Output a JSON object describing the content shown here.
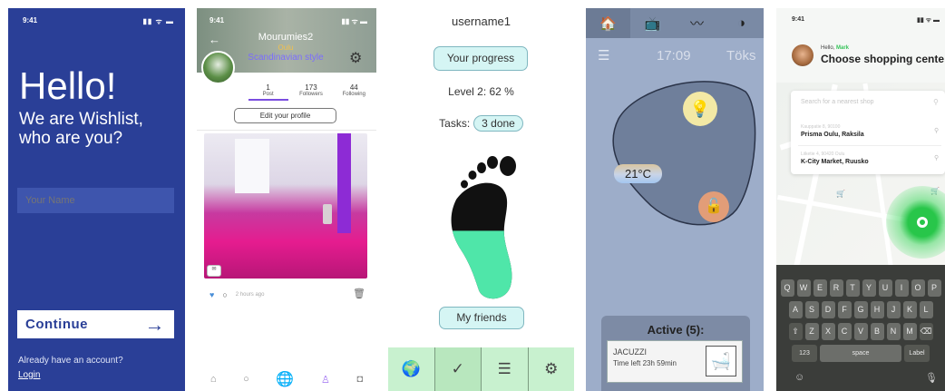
{
  "screen1": {
    "status_time": "9:41",
    "status_icons": "▮▮ ᯤ ▬",
    "hello": "Hello!",
    "intro": "We are Wishlist, who are you?",
    "name_placeholder": "Your Name",
    "continue_label": "Continue",
    "continue_arrow": "→",
    "already_text": "Already have an account?",
    "login_label": "Login"
  },
  "screen2": {
    "status_time": "9:41",
    "status_icons": "▮▮ ᯤ ▬",
    "back": "←",
    "username": "Mourumies2",
    "city": "Oulu",
    "style": "Scandinavian style",
    "gear": "⚙",
    "stats": [
      {
        "value": "1",
        "label": "Post"
      },
      {
        "value": "173",
        "label": "Followers"
      },
      {
        "value": "44",
        "label": "Following"
      }
    ],
    "edit_profile": "Edit your profile",
    "comment_icon": "✉",
    "like": "♥",
    "comment": "○",
    "post_time": "2 hours ago",
    "trash": "🗑",
    "nav": {
      "home": "⌂",
      "search": "○",
      "globe": "🌐",
      "person": "♙",
      "camera": "◘"
    }
  },
  "screen3": {
    "username": "username1",
    "progress_button": "Your progress",
    "level": "Level 2: 62 %",
    "progress_percent": 62,
    "tasks_label": "Tasks:",
    "tasks_value": "3 done",
    "friends_button": "My friends",
    "tabs": [
      {
        "icon": "🌍",
        "name": "globe"
      },
      {
        "icon": "✓",
        "name": "check"
      },
      {
        "icon": "☰",
        "name": "list"
      },
      {
        "icon": "⚙",
        "name": "settings"
      }
    ],
    "colors": {
      "accent": "#d5f5f4",
      "tabbar": "#c8f1cf",
      "foot_fill": "#4fe6a9"
    }
  },
  "screen4": {
    "nav": [
      {
        "icon": "🏠",
        "name": "home"
      },
      {
        "icon": "📺",
        "name": "tv"
      },
      {
        "icon": "〰",
        "name": "chart"
      },
      {
        "icon": "◑",
        "name": "theme"
      }
    ],
    "menu": "☰",
    "time": "17:09",
    "place": "Töks",
    "temperature": "21°C",
    "bulb": "💡",
    "lock": "🔓",
    "active_title": "Active (5):",
    "card_title": "JACUZZI",
    "card_sub": "Time left 23h 59min",
    "card_icon": "🛁"
  },
  "screen5": {
    "status_time": "9:41",
    "status_icons": "▮▮ ᯤ ▬",
    "hello_prefix": "Hello, ",
    "hello_name": "Mark",
    "heading": "Choose shopping cente",
    "search_placeholder": "Search for a nearest shop",
    "search_icon": "⚲",
    "shops": [
      {
        "address": "Kauppatie 8, 90100",
        "name": "Prisma Oulu, Raksila"
      },
      {
        "address": "Liiketie 4, 90420 Oulu",
        "name": "K-City Market, Ruusko"
      }
    ],
    "pin": "⚲",
    "cart": "🛒",
    "keyboard": {
      "row1": [
        "Q",
        "W",
        "E",
        "R",
        "T",
        "Y",
        "U",
        "I",
        "O",
        "P"
      ],
      "row2": [
        "A",
        "S",
        "D",
        "F",
        "G",
        "H",
        "J",
        "K",
        "L"
      ],
      "row3": [
        "⇧",
        "Z",
        "X",
        "C",
        "V",
        "B",
        "N",
        "M",
        "⌫"
      ],
      "row4": [
        "123",
        "space",
        "Label"
      ],
      "emoji": "☺",
      "mic": "🎙"
    }
  }
}
